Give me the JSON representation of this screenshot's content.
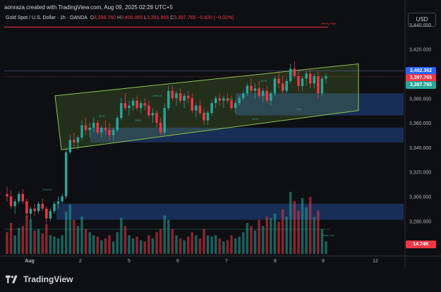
{
  "caption": "aonraza created with TradingView.com, Aug 09, 2025 02:28 UTC+5",
  "symbol": {
    "name": "Gold Spot / U.S. Dollar · 1h · OANDA",
    "o_label": "O",
    "o": "3,398.760",
    "h_label": "H",
    "h": "3,400.065",
    "l_label": "L",
    "l": "3,391.965",
    "c_label": "C",
    "c": "3,397.765",
    "change": "−0.820 (−0.02%)"
  },
  "currency_button": "USD",
  "brand": "TradingView",
  "colors": {
    "up": "#26a69a",
    "down": "#f23645",
    "channel": "#8bc34a",
    "zone": "#1e3a6e",
    "strong_high": "#f23645",
    "background": "#0e0f12"
  },
  "chart_data": {
    "type": "candlestick",
    "instrument": "XAU/USD",
    "timeframe": "1h",
    "x_ticks": [
      "Aug",
      "2",
      "5",
      "6",
      "7",
      "8",
      "9",
      "12"
    ],
    "y_ticks": [
      "3,440.000",
      "3,420.000",
      "3,400.000",
      "3,380.000",
      "3,360.000",
      "3,340.000",
      "3,320.000",
      "3,300.000",
      "3,280.000",
      "3,260.000"
    ],
    "ylim": [
      3252,
      3452
    ],
    "price_labels": [
      {
        "value": 3402.362,
        "text": "3,402.362",
        "color": "#2962ff"
      },
      {
        "value": 3397.765,
        "text": "3,397.765",
        "color": "#f23645"
      },
      {
        "value": 3397.765,
        "text": "3,397.765",
        "color": "#26a69a"
      }
    ],
    "volume_label": {
      "text": "14.74K",
      "color": "#f23645"
    },
    "annotations": [
      "Strong High",
      "Weak Low",
      "CHoCH",
      "BOS",
      "BOS",
      "CHoCH",
      "BOS",
      "BOS",
      "BOS",
      "BOS",
      "BOS",
      "EQL"
    ],
    "strong_high": 3438,
    "close_line": 3397.765,
    "channel": {
      "upper": [
        [
          3382,
          3408
        ]
      ],
      "lower": [
        [
          3338,
          3370
        ]
      ]
    },
    "zones": [
      {
        "top": 3384,
        "bottom": 3366
      },
      {
        "top": 3356,
        "bottom": 3344
      },
      {
        "top": 3294,
        "bottom": 3281
      }
    ],
    "candles": [
      [
        3302,
        3308,
        3296,
        3300
      ],
      [
        3300,
        3305,
        3290,
        3292
      ],
      [
        3292,
        3298,
        3286,
        3296
      ],
      [
        3296,
        3304,
        3294,
        3302
      ],
      [
        3302,
        3306,
        3294,
        3296
      ],
      [
        3296,
        3298,
        3283,
        3286
      ],
      [
        3286,
        3292,
        3280,
        3290
      ],
      [
        3290,
        3294,
        3284,
        3288
      ],
      [
        3288,
        3296,
        3286,
        3294
      ],
      [
        3294,
        3298,
        3288,
        3290
      ],
      [
        3290,
        3292,
        3278,
        3282
      ],
      [
        3282,
        3290,
        3280,
        3288
      ],
      [
        3288,
        3296,
        3286,
        3294
      ],
      [
        3294,
        3300,
        3290,
        3296
      ],
      [
        3296,
        3302,
        3294,
        3300
      ],
      [
        3300,
        3340,
        3298,
        3336
      ],
      [
        3336,
        3350,
        3334,
        3346
      ],
      [
        3346,
        3352,
        3340,
        3344
      ],
      [
        3344,
        3350,
        3338,
        3348
      ],
      [
        3348,
        3362,
        3346,
        3358
      ],
      [
        3358,
        3364,
        3350,
        3354
      ],
      [
        3354,
        3360,
        3348,
        3356
      ],
      [
        3356,
        3364,
        3352,
        3360
      ],
      [
        3360,
        3362,
        3350,
        3352
      ],
      [
        3352,
        3358,
        3348,
        3356
      ],
      [
        3356,
        3362,
        3350,
        3354
      ],
      [
        3354,
        3360,
        3346,
        3350
      ],
      [
        3350,
        3356,
        3346,
        3354
      ],
      [
        3354,
        3366,
        3352,
        3364
      ],
      [
        3364,
        3380,
        3362,
        3376
      ],
      [
        3376,
        3384,
        3370,
        3372
      ],
      [
        3372,
        3378,
        3366,
        3374
      ],
      [
        3374,
        3380,
        3370,
        3378
      ],
      [
        3378,
        3382,
        3370,
        3372
      ],
      [
        3372,
        3378,
        3368,
        3376
      ],
      [
        3376,
        3380,
        3370,
        3374
      ],
      [
        3374,
        3378,
        3364,
        3366
      ],
      [
        3366,
        3372,
        3360,
        3368
      ],
      [
        3368,
        3370,
        3356,
        3360
      ],
      [
        3360,
        3364,
        3350,
        3352
      ],
      [
        3352,
        3376,
        3350,
        3372
      ],
      [
        3372,
        3390,
        3370,
        3386
      ],
      [
        3386,
        3390,
        3378,
        3380
      ],
      [
        3380,
        3386,
        3374,
        3384
      ],
      [
        3384,
        3388,
        3376,
        3378
      ],
      [
        3378,
        3384,
        3372,
        3382
      ],
      [
        3382,
        3386,
        3376,
        3380
      ],
      [
        3380,
        3384,
        3368,
        3370
      ],
      [
        3370,
        3376,
        3364,
        3374
      ],
      [
        3374,
        3378,
        3366,
        3368
      ],
      [
        3368,
        3372,
        3358,
        3362
      ],
      [
        3362,
        3370,
        3358,
        3368
      ],
      [
        3368,
        3378,
        3366,
        3376
      ],
      [
        3376,
        3382,
        3372,
        3380
      ],
      [
        3380,
        3384,
        3374,
        3378
      ],
      [
        3378,
        3382,
        3372,
        3380
      ],
      [
        3380,
        3384,
        3376,
        3378
      ],
      [
        3378,
        3382,
        3370,
        3372
      ],
      [
        3372,
        3378,
        3368,
        3376
      ],
      [
        3376,
        3382,
        3374,
        3380
      ],
      [
        3380,
        3386,
        3378,
        3384
      ],
      [
        3384,
        3392,
        3382,
        3390
      ],
      [
        3390,
        3396,
        3384,
        3386
      ],
      [
        3386,
        3392,
        3380,
        3388
      ],
      [
        3388,
        3394,
        3380,
        3382
      ],
      [
        3382,
        3388,
        3376,
        3386
      ],
      [
        3386,
        3390,
        3376,
        3378
      ],
      [
        3378,
        3386,
        3374,
        3384
      ],
      [
        3384,
        3398,
        3382,
        3396
      ],
      [
        3396,
        3402,
        3388,
        3392
      ],
      [
        3392,
        3398,
        3384,
        3386
      ],
      [
        3386,
        3396,
        3384,
        3394
      ],
      [
        3394,
        3408,
        3392,
        3404
      ],
      [
        3404,
        3410,
        3396,
        3398
      ],
      [
        3398,
        3402,
        3386,
        3390
      ],
      [
        3390,
        3398,
        3386,
        3396
      ],
      [
        3396,
        3402,
        3390,
        3400
      ],
      [
        3400,
        3404,
        3388,
        3392
      ],
      [
        3392,
        3400,
        3388,
        3398
      ],
      [
        3398,
        3402,
        3380,
        3384
      ],
      [
        3384,
        3398,
        3382,
        3396
      ],
      [
        3396,
        3400,
        3392,
        3398
      ]
    ],
    "volumes": [
      0.35,
      0.5,
      0.3,
      0.42,
      0.45,
      0.62,
      0.55,
      0.38,
      0.4,
      0.33,
      0.48,
      0.3,
      0.28,
      0.25,
      0.3,
      0.68,
      0.8,
      0.55,
      0.45,
      0.6,
      0.4,
      0.35,
      0.3,
      0.28,
      0.22,
      0.25,
      0.3,
      0.2,
      0.35,
      0.58,
      0.45,
      0.3,
      0.25,
      0.28,
      0.22,
      0.2,
      0.3,
      0.25,
      0.35,
      0.4,
      0.62,
      0.55,
      0.4,
      0.3,
      0.25,
      0.22,
      0.28,
      0.35,
      0.3,
      0.25,
      0.4,
      0.3,
      0.28,
      0.3,
      0.25,
      0.2,
      0.22,
      0.3,
      0.25,
      0.28,
      0.35,
      0.5,
      0.45,
      0.38,
      0.55,
      0.45,
      0.6,
      0.58,
      0.65,
      0.52,
      0.72,
      0.6,
      1.0,
      0.85,
      0.7,
      0.9,
      0.75,
      0.92,
      0.6,
      0.7,
      0.4,
      0.2
    ]
  }
}
